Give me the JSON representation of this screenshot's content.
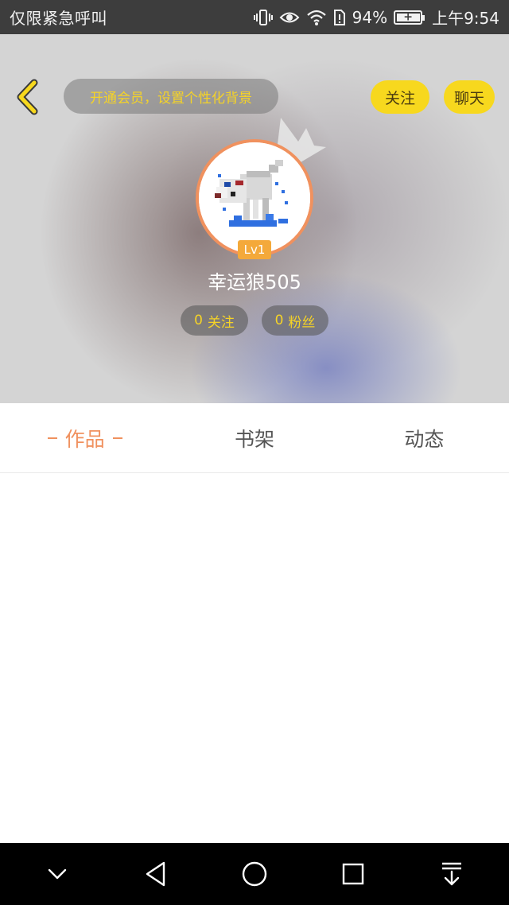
{
  "status_bar": {
    "left_text": "仅限紧急呼叫",
    "battery": "94%",
    "time": "上午9:54",
    "icons": [
      "vibrate-icon",
      "eye-icon",
      "wifi-icon",
      "sim-icon",
      "battery-charging-icon"
    ]
  },
  "header": {
    "back_icon": "chevron-left-icon",
    "vip_prompt": "开通会员，设置个性化背景",
    "follow_label": "关注",
    "chat_label": "聊天"
  },
  "profile": {
    "avatar_icon": "pixel-wolf-avatar",
    "level": "Lv1",
    "username": "幸运狼505",
    "following_count": "0",
    "following_label": "关注",
    "fans_count": "0",
    "fans_label": "粉丝"
  },
  "tabs": [
    {
      "label": "作品",
      "active": true
    },
    {
      "label": "书架",
      "active": false
    },
    {
      "label": "动态",
      "active": false
    }
  ],
  "colors": {
    "accent_orange": "#f0915e",
    "button_yellow": "#f7d81e",
    "pill_text_yellow": "#f5d327",
    "level_badge": "#f4a93a"
  },
  "nav_bar": {
    "icons": [
      "chevron-down-icon",
      "back-triangle-icon",
      "home-circle-icon",
      "recents-square-icon",
      "download-icon"
    ]
  }
}
